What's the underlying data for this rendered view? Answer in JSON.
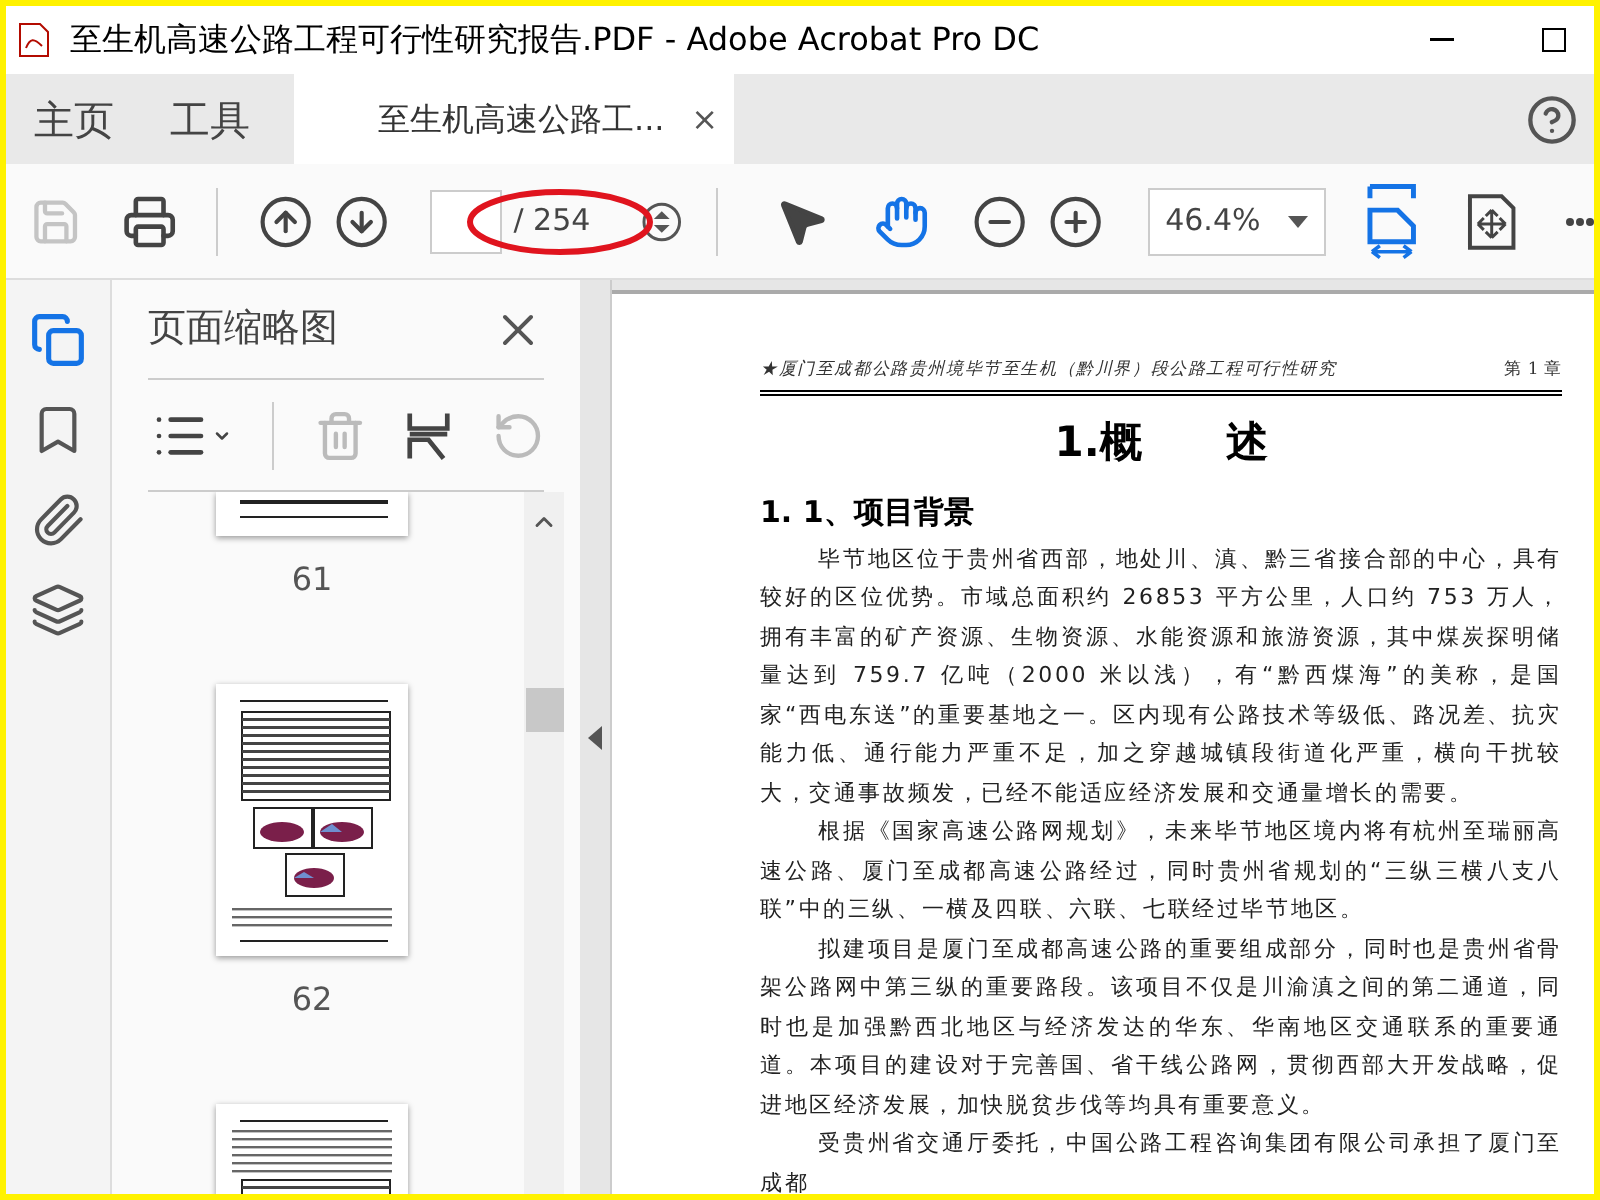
{
  "window": {
    "title": "至生机高速公路工程可行性研究报告.PDF - Adobe Acrobat Pro DC"
  },
  "nav_tabs": [
    {
      "label": "主页",
      "selected": false
    },
    {
      "label": "工具",
      "selected": false
    }
  ],
  "document_tabs": [
    {
      "label": "至生机高速公路工...",
      "selected": true,
      "close": "×"
    }
  ],
  "toolbar": {
    "save_disabled": true,
    "page_count": "/ 254",
    "zoom": "46.4%",
    "tools": [
      {
        "kind": "select",
        "selected": false
      },
      {
        "kind": "hand",
        "selected": true
      }
    ]
  },
  "side_rail": [
    {
      "kind": "pages",
      "selected": true
    },
    {
      "kind": "bookmarks",
      "selected": false
    },
    {
      "kind": "attachments",
      "selected": false
    },
    {
      "kind": "layers",
      "selected": false
    }
  ],
  "panel": {
    "title": "页面缩略图",
    "actions": [
      {
        "kind": "options",
        "disabled": false
      },
      {
        "kind": "delete",
        "disabled": true
      },
      {
        "kind": "extract",
        "disabled": false
      },
      {
        "kind": "rotate",
        "disabled": true
      }
    ],
    "thumbnails": [
      {
        "kind": "partial",
        "label": "61"
      },
      {
        "kind": "charts",
        "label": "62"
      },
      {
        "kind": "table"
      }
    ]
  },
  "document": {
    "running_header": "★厦门至成都公路贵州境毕节至生机（黔川界）段公路工程可行性研究",
    "chapter": "第 1 章",
    "title": "1.概　　述",
    "section": "1. 1、项目背景",
    "paragraphs": [
      "毕节地区位于贵州省西部，地处川、滇、黔三省接合部的中心，具有较好的区位优势。市域总面积约 26853 平方公里，人口约 753 万人，拥有丰富的矿产资源、生物资源、水能资源和旅游资源，其中煤炭探明储量达到 759.7 亿吨（2000 米以浅），有“黔西煤海”的美称，是国家“西电东送”的重要基地之一。区内现有公路技术等级低、路况差、抗灾能力低、通行能力严重不足，加之穿越城镇段街道化严重，横向干扰较大，交通事故频发，已经不能适应经济发展和交通量增长的需要。",
      "根据《国家高速公路网规划》，未来毕节地区境内将有杭州至瑞丽高速公路、厦门至成都高速公路经过，同时贵州省规划的“三纵三横八支八联”中的三纵、一横及四联、六联、七联经过毕节地区。",
      "拟建项目是厦门至成都高速公路的重要组成部分，同时也是贵州省骨架公路网中第三纵的重要路段。该项目不仅是川渝滇之间的第二通道，同时也是加强黔西北地区与经济发达的华东、华南地区交通联系的重要通道。本项目的建设对于完善国、省干线公路网，贯彻西部大开发战略，促进地区经济发展，加快脱贫步伐等均具有重要意义。",
      "受贵州省交通厅委托，中国公路工程咨询集团有限公司承担了厦门至成都"
    ]
  }
}
